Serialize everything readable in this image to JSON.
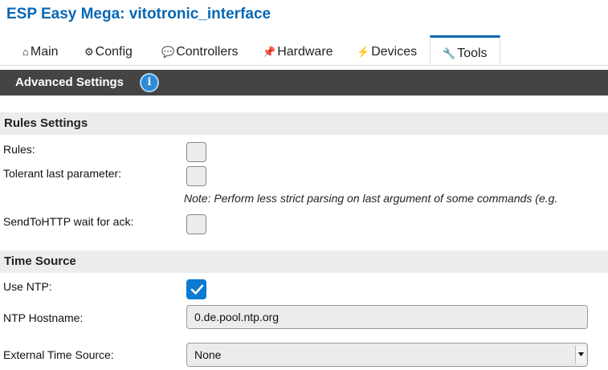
{
  "app": {
    "title": "ESP Easy Mega: vitotronic_interface"
  },
  "tabs": [
    {
      "icon": "⌂",
      "label": "Main"
    },
    {
      "icon": "⚙",
      "label": "Config"
    },
    {
      "icon": "💬",
      "label": "Controllers"
    },
    {
      "icon": "📌",
      "label": "Hardware"
    },
    {
      "icon": "⚡",
      "label": "Devices"
    },
    {
      "icon": "🔧",
      "label": "Tools",
      "active": true
    }
  ],
  "header": {
    "title": "Advanced Settings",
    "info_icon": "i"
  },
  "rules_section": {
    "title": "Rules Settings",
    "rules_label": "Rules:",
    "tolerant_label": "Tolerant last parameter:",
    "tolerant_note": "Note: Perform less strict parsing on last argument of some commands (e.g.",
    "sendtohttp_label": "SendToHTTP wait for ack:"
  },
  "time_section": {
    "title": "Time Source",
    "use_ntp_label": "Use NTP:",
    "use_ntp_checked": true,
    "ntp_hostname_label": "NTP Hostname:",
    "ntp_hostname_value": "0.de.pool.ntp.org",
    "external_time_label": "External Time Source:",
    "external_time_value": "None"
  },
  "colors": {
    "accent": "#0767b5",
    "header_bg": "#444444",
    "section_bg": "#ececec",
    "checkbox_checked": "#0b7ad1"
  }
}
